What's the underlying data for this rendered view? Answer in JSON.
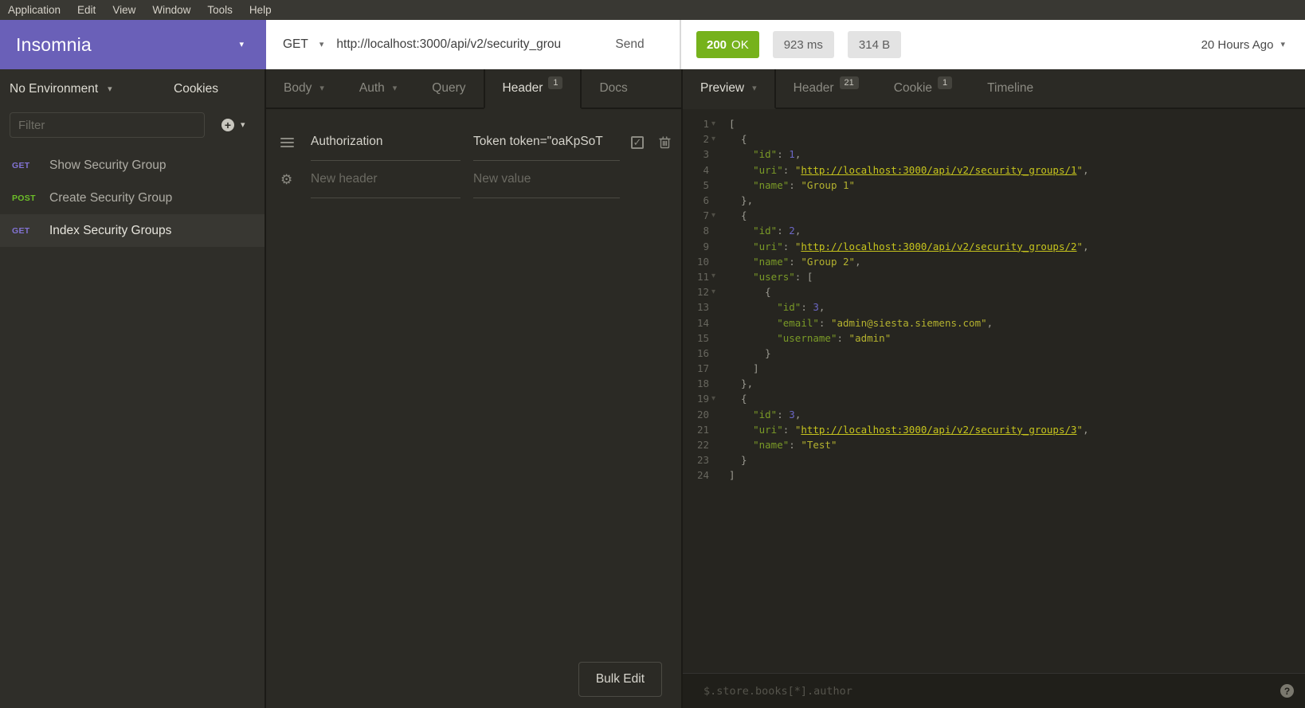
{
  "menubar": {
    "items": [
      "Application",
      "Edit",
      "View",
      "Window",
      "Tools",
      "Help"
    ]
  },
  "app": {
    "title": "Insomnia"
  },
  "request_bar": {
    "method": "GET",
    "url": "http://localhost:3000/api/v2/security_grou",
    "send_label": "Send"
  },
  "response_meta": {
    "status_code": "200",
    "status_text": "OK",
    "time": "923 ms",
    "size": "314 B",
    "history": "20 Hours Ago"
  },
  "sidebar": {
    "environment": "No Environment",
    "cookies_label": "Cookies",
    "filter_placeholder": "Filter",
    "requests": [
      {
        "method": "GET",
        "name": "Show Security Group",
        "selected": false
      },
      {
        "method": "POST",
        "name": "Create Security Group",
        "selected": false
      },
      {
        "method": "GET",
        "name": "Index Security Groups",
        "selected": true
      }
    ]
  },
  "request_panel": {
    "tabs": [
      {
        "label": "Body",
        "caret": true
      },
      {
        "label": "Auth",
        "caret": true
      },
      {
        "label": "Query"
      },
      {
        "label": "Header",
        "badge": "1",
        "active": true
      },
      {
        "label": "Docs"
      }
    ],
    "header_row": {
      "name": "Authorization",
      "value": "Token token=\"oaKpSoT"
    },
    "new_header_placeholder": "New header",
    "new_value_placeholder": "New value",
    "bulk_edit_label": "Bulk Edit"
  },
  "response_panel": {
    "tabs": [
      {
        "label": "Preview",
        "caret": true,
        "active": true
      },
      {
        "label": "Header",
        "badge": "21"
      },
      {
        "label": "Cookie",
        "badge": "1"
      },
      {
        "label": "Timeline"
      }
    ],
    "filter_placeholder": "$.store.books[*].author",
    "help_icon": "question-mark",
    "body_lines": [
      {
        "n": 1,
        "fold": true,
        "tokens": [
          [
            "p",
            "["
          ]
        ]
      },
      {
        "n": 2,
        "fold": true,
        "tokens": [
          [
            "p",
            "  {"
          ]
        ]
      },
      {
        "n": 3,
        "fold": false,
        "tokens": [
          [
            "p",
            "    "
          ],
          [
            "k",
            "\"id\""
          ],
          [
            "p",
            ": "
          ],
          [
            "n",
            "1"
          ],
          [
            "p",
            ","
          ]
        ]
      },
      {
        "n": 4,
        "fold": false,
        "tokens": [
          [
            "p",
            "    "
          ],
          [
            "k",
            "\"uri\""
          ],
          [
            "p",
            ": "
          ],
          [
            "s",
            "\""
          ],
          [
            "u",
            "http://localhost:3000/api/v2/security_groups/1"
          ],
          [
            "s",
            "\""
          ],
          [
            "p",
            ","
          ]
        ]
      },
      {
        "n": 5,
        "fold": false,
        "tokens": [
          [
            "p",
            "    "
          ],
          [
            "k",
            "\"name\""
          ],
          [
            "p",
            ": "
          ],
          [
            "s",
            "\"Group 1\""
          ]
        ]
      },
      {
        "n": 6,
        "fold": false,
        "tokens": [
          [
            "p",
            "  },"
          ]
        ]
      },
      {
        "n": 7,
        "fold": true,
        "tokens": [
          [
            "p",
            "  {"
          ]
        ]
      },
      {
        "n": 8,
        "fold": false,
        "tokens": [
          [
            "p",
            "    "
          ],
          [
            "k",
            "\"id\""
          ],
          [
            "p",
            ": "
          ],
          [
            "n",
            "2"
          ],
          [
            "p",
            ","
          ]
        ]
      },
      {
        "n": 9,
        "fold": false,
        "tokens": [
          [
            "p",
            "    "
          ],
          [
            "k",
            "\"uri\""
          ],
          [
            "p",
            ": "
          ],
          [
            "s",
            "\""
          ],
          [
            "u",
            "http://localhost:3000/api/v2/security_groups/2"
          ],
          [
            "s",
            "\""
          ],
          [
            "p",
            ","
          ]
        ]
      },
      {
        "n": 10,
        "fold": false,
        "tokens": [
          [
            "p",
            "    "
          ],
          [
            "k",
            "\"name\""
          ],
          [
            "p",
            ": "
          ],
          [
            "s",
            "\"Group 2\""
          ],
          [
            "p",
            ","
          ]
        ]
      },
      {
        "n": 11,
        "fold": true,
        "tokens": [
          [
            "p",
            "    "
          ],
          [
            "k",
            "\"users\""
          ],
          [
            "p",
            ": ["
          ]
        ]
      },
      {
        "n": 12,
        "fold": true,
        "tokens": [
          [
            "p",
            "      {"
          ]
        ]
      },
      {
        "n": 13,
        "fold": false,
        "tokens": [
          [
            "p",
            "        "
          ],
          [
            "k",
            "\"id\""
          ],
          [
            "p",
            ": "
          ],
          [
            "n",
            "3"
          ],
          [
            "p",
            ","
          ]
        ]
      },
      {
        "n": 14,
        "fold": false,
        "tokens": [
          [
            "p",
            "        "
          ],
          [
            "k",
            "\"email\""
          ],
          [
            "p",
            ": "
          ],
          [
            "s",
            "\"admin@siesta.siemens.com\""
          ],
          [
            "p",
            ","
          ]
        ]
      },
      {
        "n": 15,
        "fold": false,
        "tokens": [
          [
            "p",
            "        "
          ],
          [
            "k",
            "\"username\""
          ],
          [
            "p",
            ": "
          ],
          [
            "s",
            "\"admin\""
          ]
        ]
      },
      {
        "n": 16,
        "fold": false,
        "tokens": [
          [
            "p",
            "      }"
          ]
        ]
      },
      {
        "n": 17,
        "fold": false,
        "tokens": [
          [
            "p",
            "    ]"
          ]
        ]
      },
      {
        "n": 18,
        "fold": false,
        "tokens": [
          [
            "p",
            "  },"
          ]
        ]
      },
      {
        "n": 19,
        "fold": true,
        "tokens": [
          [
            "p",
            "  {"
          ]
        ]
      },
      {
        "n": 20,
        "fold": false,
        "tokens": [
          [
            "p",
            "    "
          ],
          [
            "k",
            "\"id\""
          ],
          [
            "p",
            ": "
          ],
          [
            "n",
            "3"
          ],
          [
            "p",
            ","
          ]
        ]
      },
      {
        "n": 21,
        "fold": false,
        "tokens": [
          [
            "p",
            "    "
          ],
          [
            "k",
            "\"uri\""
          ],
          [
            "p",
            ": "
          ],
          [
            "s",
            "\""
          ],
          [
            "u",
            "http://localhost:3000/api/v2/security_groups/3"
          ],
          [
            "s",
            "\""
          ],
          [
            "p",
            ","
          ]
        ]
      },
      {
        "n": 22,
        "fold": false,
        "tokens": [
          [
            "p",
            "    "
          ],
          [
            "k",
            "\"name\""
          ],
          [
            "p",
            ": "
          ],
          [
            "s",
            "\"Test\""
          ]
        ]
      },
      {
        "n": 23,
        "fold": false,
        "tokens": [
          [
            "p",
            "  }"
          ]
        ]
      },
      {
        "n": 24,
        "fold": false,
        "tokens": [
          [
            "p",
            "]"
          ]
        ]
      }
    ]
  },
  "colors": {
    "c-topbar": "#393833",
    "c-topbar-text": "#d6d2c9",
    "c-purple": "#6a60b8",
    "c-green": "#76b21c",
    "c-sidebar": "#2f2e29",
    "c-panel": "#2b2a25",
    "c-editor": "#262520",
    "c-border": "#1b1a16",
    "c-get": "#8273d3",
    "c-post": "#6dbf29",
    "tok-punct": "#9b9a91",
    "tok-key": "#7a9a27",
    "tok-str": "#b4b22f",
    "tok-url": "#c6c41d",
    "tok-num": "#6b67c5"
  }
}
